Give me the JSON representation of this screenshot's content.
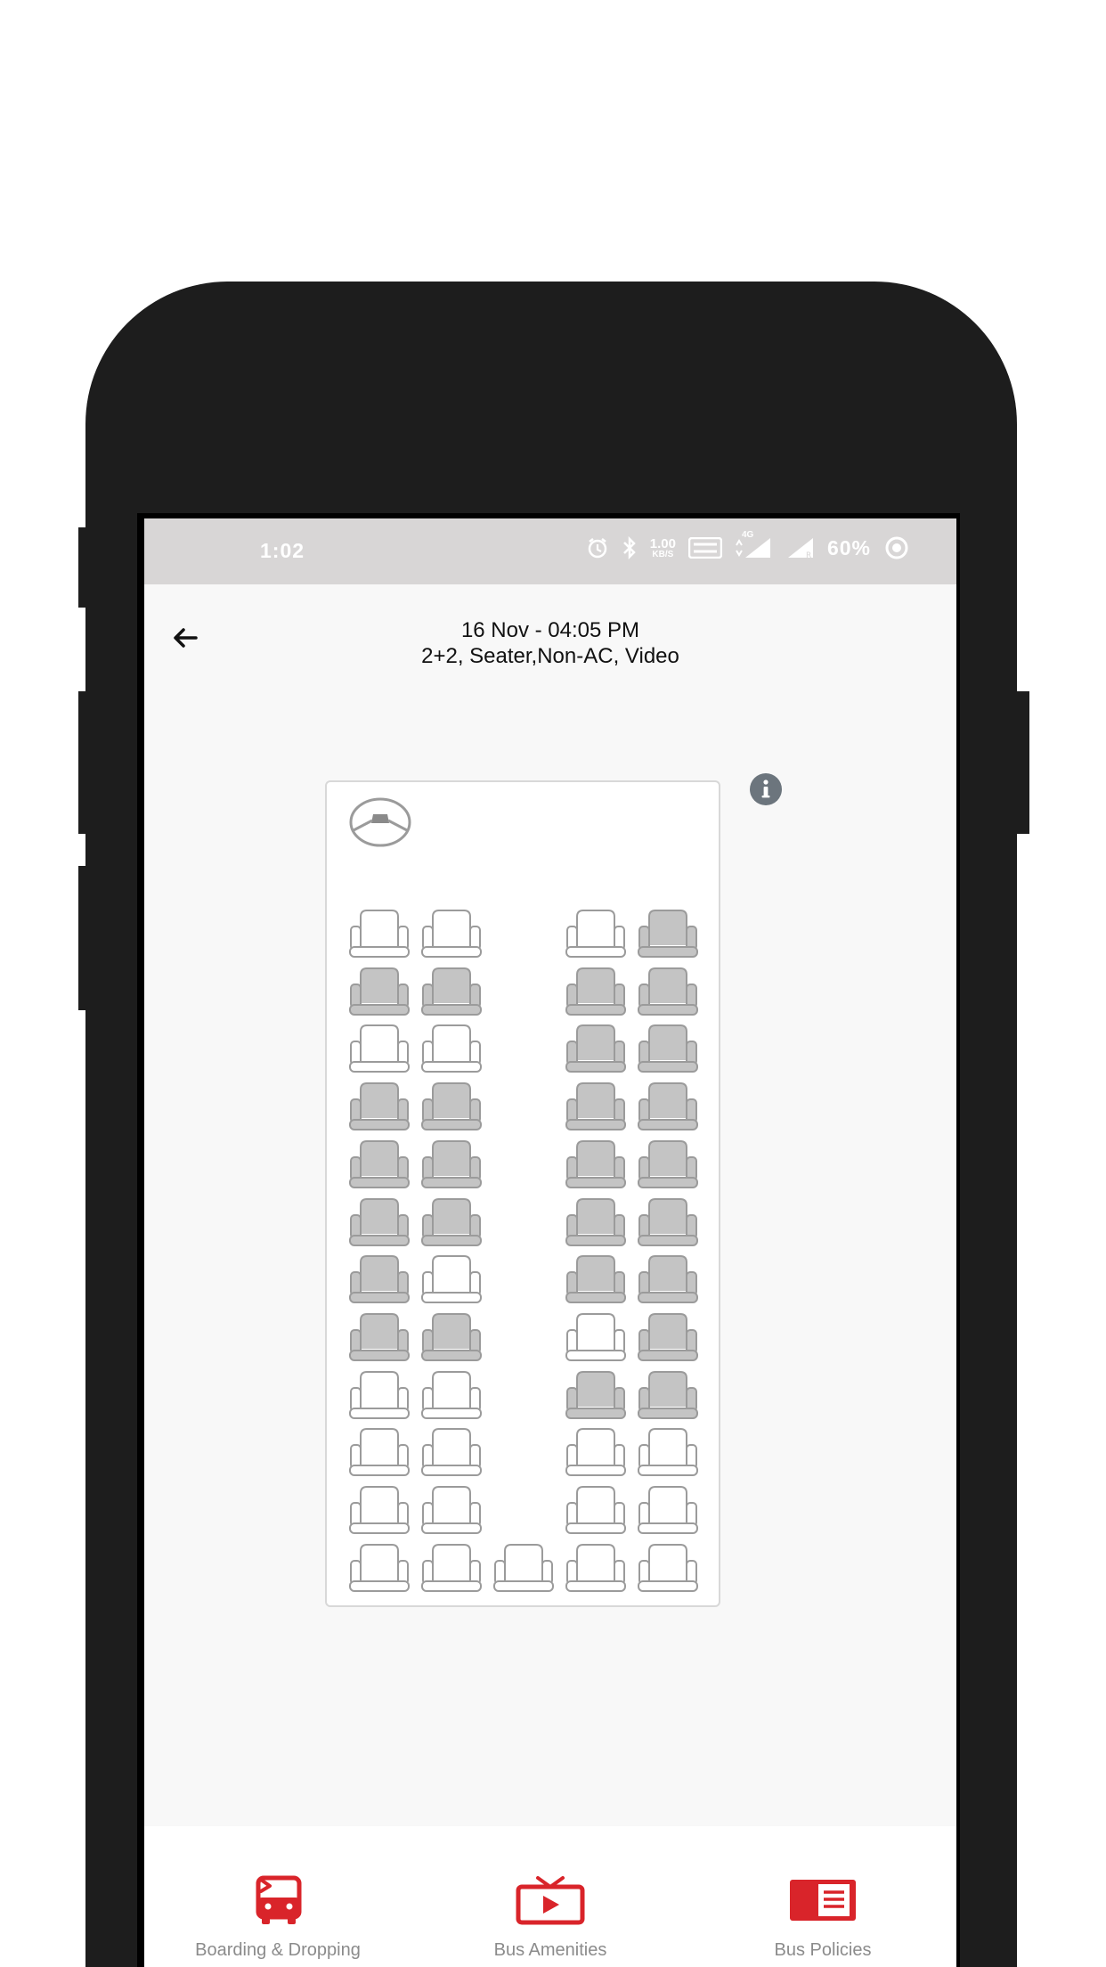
{
  "status_bar": {
    "time": "1:02",
    "speed": "1.00",
    "speed_unit": "KB/S",
    "network": "4G",
    "battery": "60%"
  },
  "header": {
    "date_time": "16 Nov - 04:05 PM",
    "bus_type": "2+2, Seater,Non-AC, Video"
  },
  "seat_map": {
    "columns_per_row": 5,
    "legend": {
      "available": "white",
      "booked": "grey"
    },
    "rows": [
      [
        "available",
        "available",
        null,
        "available",
        "booked"
      ],
      [
        "booked",
        "booked",
        null,
        "booked",
        "booked"
      ],
      [
        "available",
        "available",
        null,
        "booked",
        "booked"
      ],
      [
        "booked",
        "booked",
        null,
        "booked",
        "booked"
      ],
      [
        "booked",
        "booked",
        null,
        "booked",
        "booked"
      ],
      [
        "booked",
        "booked",
        null,
        "booked",
        "booked"
      ],
      [
        "booked",
        "available",
        null,
        "booked",
        "booked"
      ],
      [
        "booked",
        "booked",
        null,
        "available",
        "booked"
      ],
      [
        "available",
        "available",
        null,
        "booked",
        "booked"
      ],
      [
        "available",
        "available",
        null,
        "available",
        "available"
      ],
      [
        "available",
        "available",
        null,
        "available",
        "available"
      ],
      [
        "available",
        "available",
        "available",
        "available",
        "available"
      ]
    ]
  },
  "bottom_nav": [
    {
      "label": "Boarding & Dropping",
      "icon": "bus-icon"
    },
    {
      "label": "Bus Amenities",
      "icon": "tv-icon"
    },
    {
      "label": "Bus Policies",
      "icon": "policy-document-icon"
    }
  ],
  "colors": {
    "accent": "#d9242a",
    "seat_available_fill": "#ffffff",
    "seat_booked_fill": "#c4c4c4",
    "seat_stroke": "#9b9b9b",
    "status_bar": "#d8d6d6"
  }
}
